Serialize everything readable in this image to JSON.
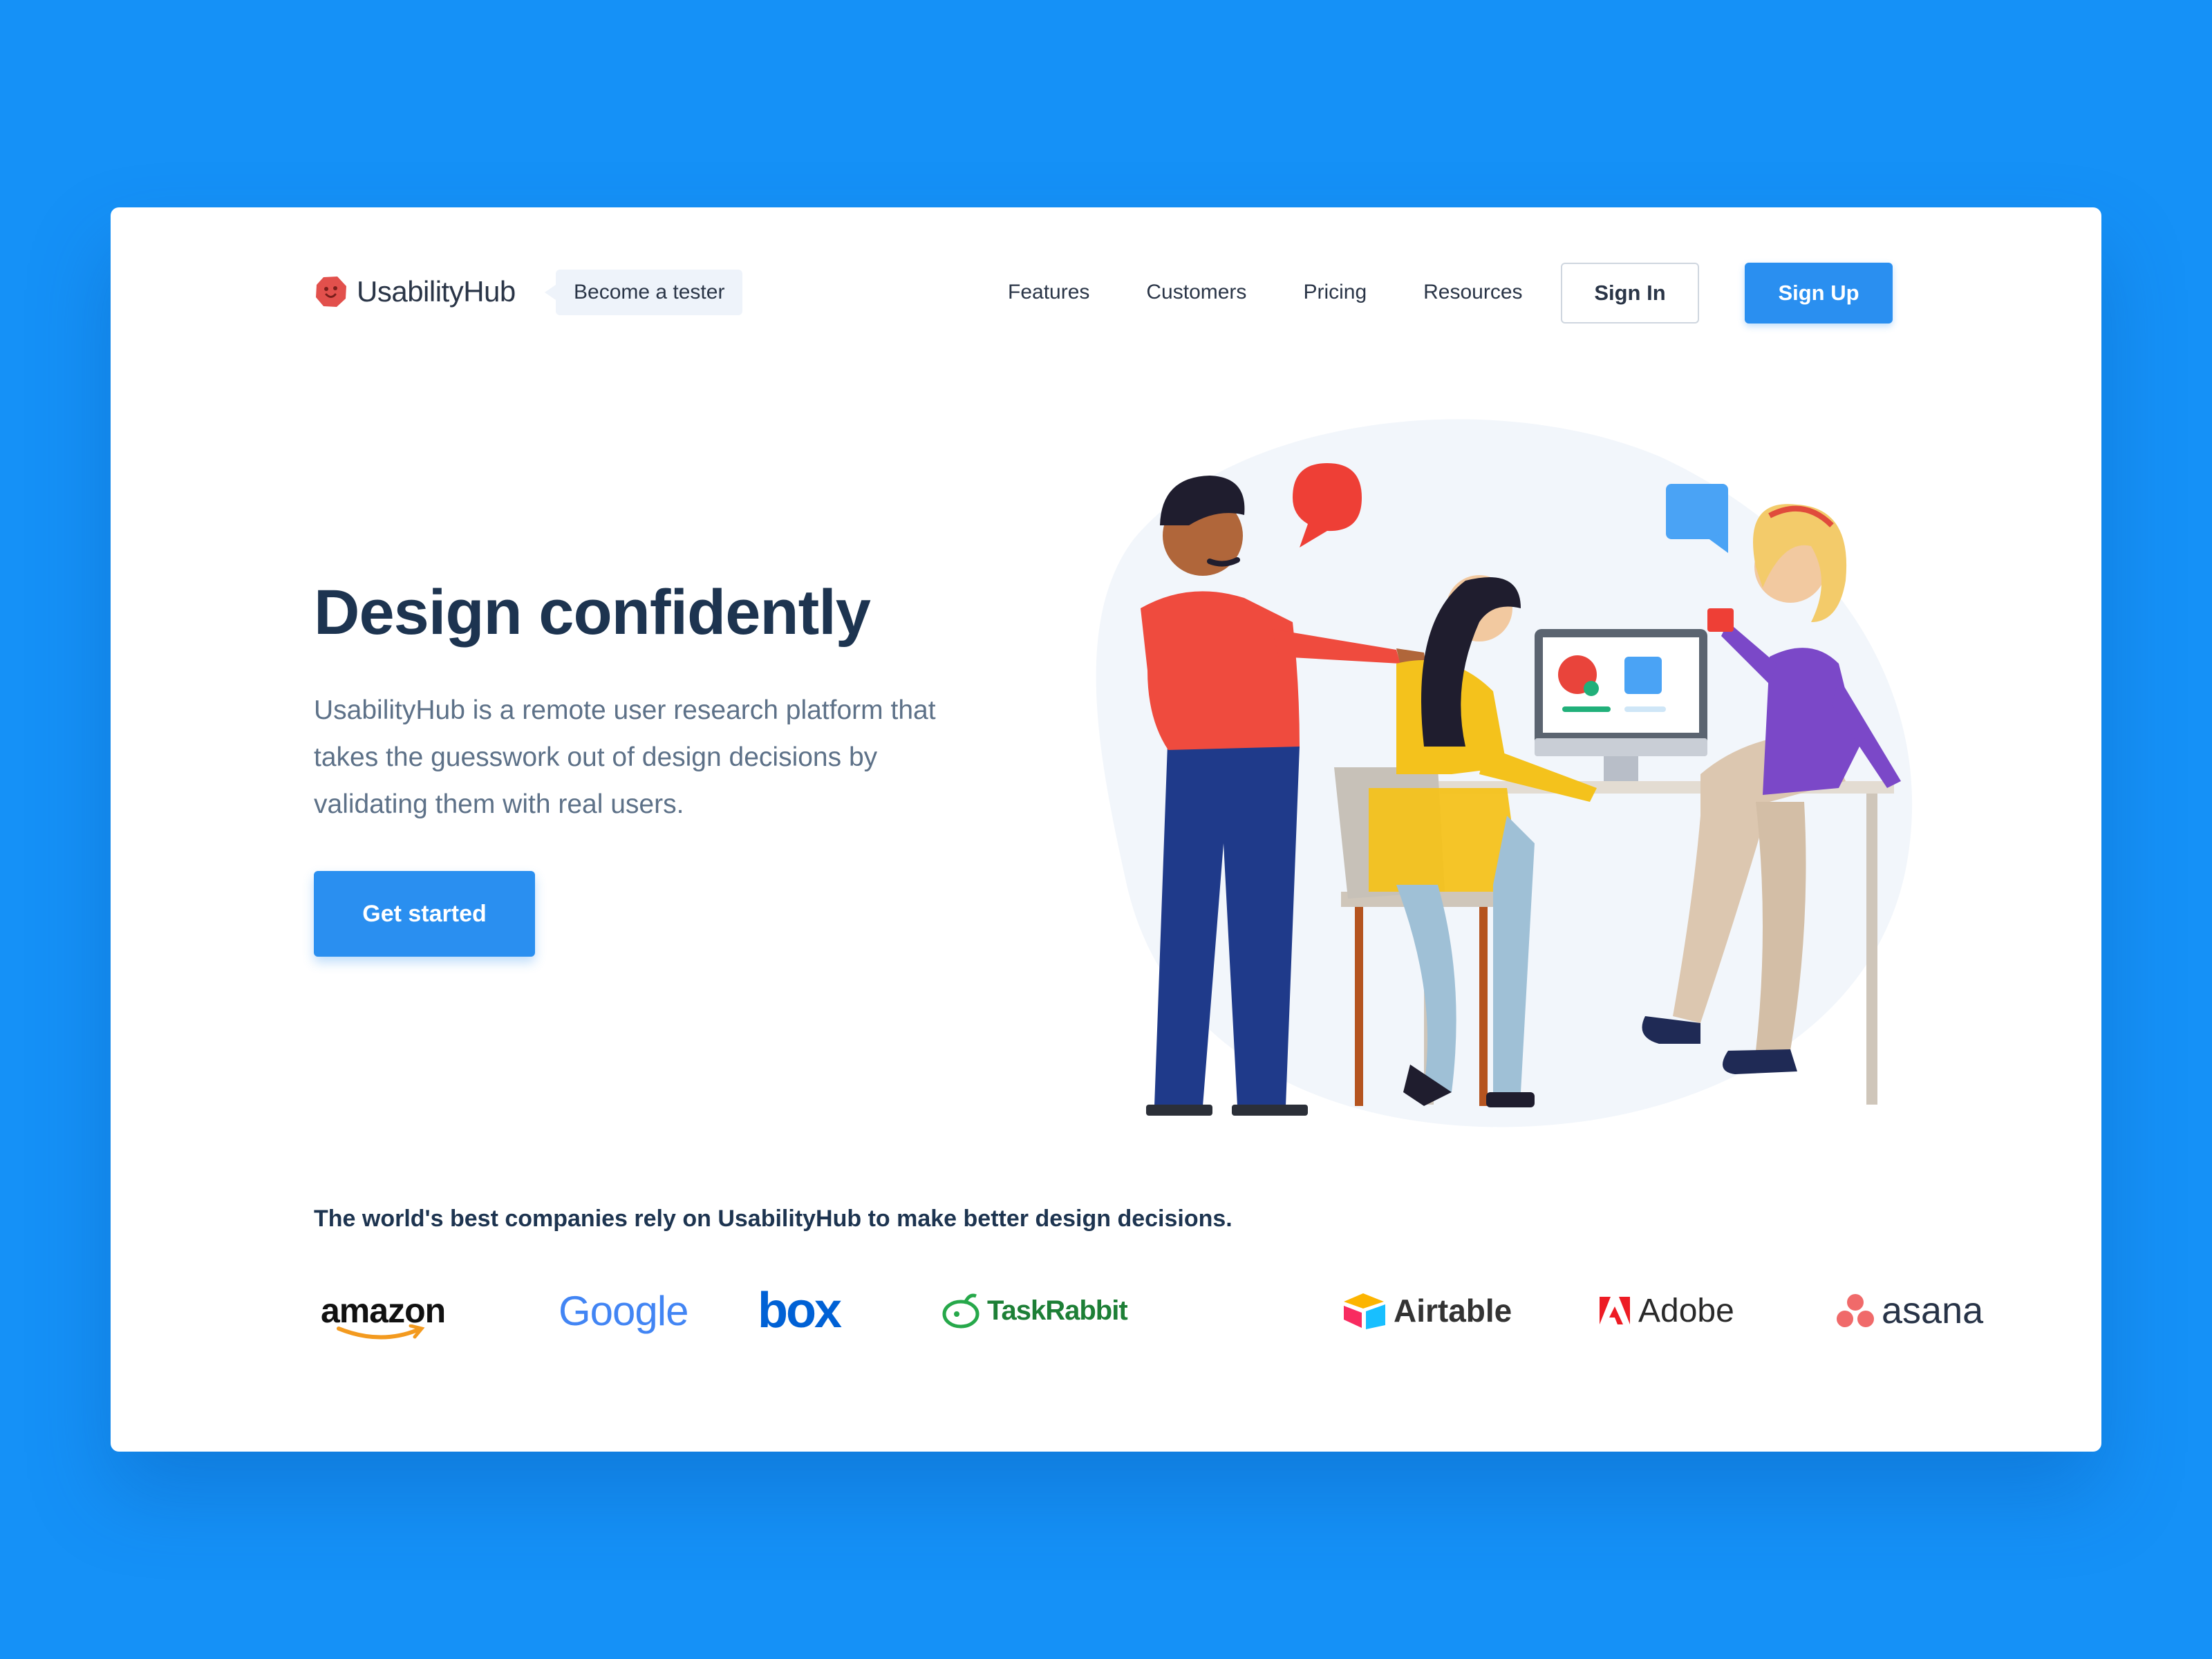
{
  "brand": {
    "name": "UsabilityHub"
  },
  "nav": {
    "tester_label": "Become a tester",
    "links": [
      "Features",
      "Customers",
      "Pricing",
      "Resources"
    ],
    "sign_in": "Sign In",
    "sign_up": "Sign Up"
  },
  "hero": {
    "title": "Design confidently",
    "subtitle": "UsabilityHub is a remote user research platform that takes the guesswork out of design decisions by validating them with real users.",
    "cta": "Get started"
  },
  "customers": {
    "heading": "The world's best companies rely on UsabilityHub to make better design decisions.",
    "logos": [
      "amazon",
      "Google",
      "box",
      "TaskRabbit",
      "Airtable",
      "Adobe",
      "asana"
    ]
  },
  "colors": {
    "background": "#1591f7",
    "accent": "#2a8ff0",
    "heading": "#1d3450",
    "body_text": "#5d7188"
  }
}
